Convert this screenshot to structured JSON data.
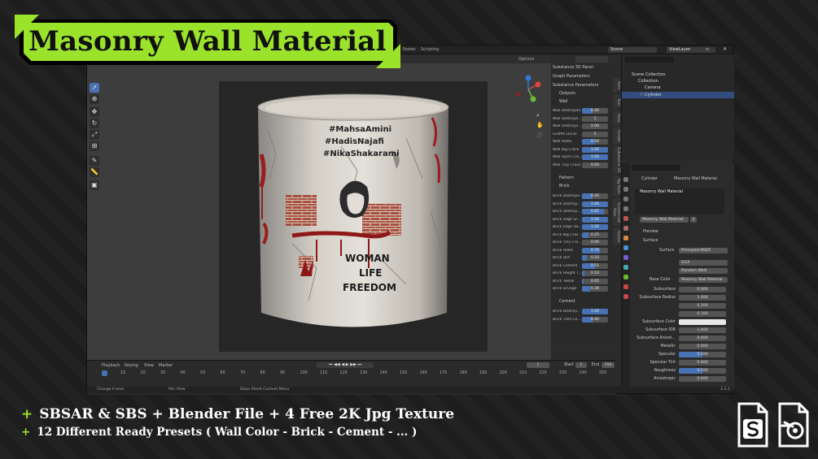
{
  "banner": {
    "title": "Masonry Wall Material",
    "bullets": [
      "SBSAR & SBS + Blender File + 4 Free 2K Jpg Texture",
      "12 Different Ready Presets ( Wall Color - Brick - Cement - ... )"
    ],
    "plus": "+",
    "accent_color": "#9be22a",
    "file_icons": [
      "substance-file-icon",
      "blender-file-icon"
    ]
  },
  "blender": {
    "tabs": [
      "Nodes",
      "Scripting"
    ],
    "scene_label": "Scene",
    "view_layer": "ViewLayer",
    "options_label": "Options",
    "substance_panel": {
      "headers": {
        "panel": "Substance 3D Panel",
        "graph": "Graph Parameters",
        "params": "Substance Parameters",
        "outputs": "Outputs",
        "wall": "Wall",
        "pattern": "Pattern",
        "brick": "Brick",
        "cement": "Cement"
      },
      "wall_params": [
        {
          "label": "Wall Destroyed",
          "value": "0.40",
          "fill": 0.4
        },
        {
          "label": "Wall Destroye...",
          "value": "1",
          "fill": 0
        },
        {
          "label": "Wall Destroye...",
          "value": "2.00",
          "fill": 0
        },
        {
          "label": "Graffiti Decal",
          "value": "1",
          "fill": 0
        },
        {
          "label": "Wall Holes",
          "value": "0.50",
          "fill": 0.5
        },
        {
          "label": "Wall Big Crack",
          "value": "1.00",
          "fill": 1.0
        },
        {
          "label": "Wall Open Cra...",
          "value": "1.00",
          "fill": 1.0
        },
        {
          "label": "Wall Tiny Crack",
          "value": "0.00",
          "fill": 0
        }
      ],
      "brick_params": [
        {
          "label": "Brick Destroye...",
          "value": "0.40",
          "fill": 0.4
        },
        {
          "label": "Brick Destroy...",
          "value": "1.00",
          "fill": 1.0
        },
        {
          "label": "Brick Destroy...",
          "value": "0.85",
          "fill": 0.85
        },
        {
          "label": "Brick edge Sc...",
          "value": "1.00",
          "fill": 1.0
        },
        {
          "label": "Brick Edge Da...",
          "value": "1.00",
          "fill": 1.0
        },
        {
          "label": "Brick Big Crac...",
          "value": "0.25",
          "fill": 0.25
        },
        {
          "label": "Brick Tiny Cra...",
          "value": "0.00",
          "fill": 0
        },
        {
          "label": "Brick Holes",
          "value": "0.70",
          "fill": 0.7
        },
        {
          "label": "Brick Dirt",
          "value": "0.20",
          "fill": 0.2
        },
        {
          "label": "Brick Cement",
          "value": "0.51",
          "fill": 0.51
        },
        {
          "label": "Brick Height T...",
          "value": "0.10",
          "fill": 0.1
        },
        {
          "label": "Brick Tweak",
          "value": "0.05",
          "fill": 0.05
        },
        {
          "label": "Brick Grunge",
          "value": "0.30",
          "fill": 0.3
        }
      ],
      "cement_params": [
        {
          "label": "Brick Destroy...",
          "value": "1.00",
          "fill": 1.0
        },
        {
          "label": "Brick Tiles Co...",
          "value": "0.40",
          "fill": 0.4
        }
      ]
    },
    "side_tabs": [
      "Item",
      "Tool",
      "View",
      "Create",
      "Substance 3D",
      "Bg Tools",
      "Screencast Keys",
      "Quixel"
    ],
    "outliner": {
      "scene_collection": "Scene Collection",
      "collection": "Collection",
      "camera": "Camera",
      "cylinder": "Cylinder"
    },
    "properties": {
      "object_name": "Cylinder",
      "material_name": "Masonry Wall Material",
      "slot_material": "Masonry Wall Material",
      "users": "2",
      "preview": "Preview",
      "surface_header": "Surface",
      "surface_label": "Surface",
      "surface_value": "Principled BSDF",
      "distribution": "GGX",
      "subsurface_method": "Random Walk",
      "base_color_label": "Base Color",
      "base_color_value": "Masonry Wall Material",
      "rows": [
        {
          "label": "Subsurface",
          "value": "0.000",
          "fill": 0
        },
        {
          "label": "Subsurface Radius",
          "value": "1.000",
          "fill": 0
        },
        {
          "label": "",
          "value": "0.200",
          "fill": 0
        },
        {
          "label": "",
          "value": "0.100",
          "fill": 0
        },
        {
          "label": "Subsurface Color",
          "value": "",
          "fill": 0
        },
        {
          "label": "Subsurface IOR",
          "value": "1.400",
          "fill": 0
        },
        {
          "label": "Subsurface Anisot...",
          "value": "0.000",
          "fill": 0
        },
        {
          "label": "Metallic",
          "value": "0.000",
          "fill": 0
        },
        {
          "label": "Specular",
          "value": "0.500",
          "fill": 0.5
        },
        {
          "label": "Specular Tint",
          "value": "0.000",
          "fill": 0
        },
        {
          "label": "Roughness",
          "value": "0.500",
          "fill": 0.5
        },
        {
          "label": "Anisotropic",
          "value": "0.000",
          "fill": 0
        }
      ]
    },
    "timeline": {
      "menus": [
        "Playback",
        "Keying",
        "View",
        "Marker"
      ],
      "current_frame": "1",
      "start_label": "Start",
      "start": "1",
      "end_label": "End",
      "end": "250",
      "ticks": [
        "1",
        "10",
        "20",
        "30",
        "40",
        "50",
        "60",
        "70",
        "80",
        "90",
        "100",
        "110",
        "120",
        "130",
        "140",
        "150",
        "160",
        "170",
        "180",
        "190",
        "200",
        "210",
        "220",
        "230",
        "240",
        "250"
      ]
    },
    "status": {
      "change_frame": "Change Frame",
      "pan_view": "Pan View",
      "context_menu": "Dope Sheet Context Menu",
      "version": "3.3.1"
    },
    "mug_text": {
      "hashtags": [
        "#MahsaAmini",
        "#HadisNajafi",
        "#NikaShakarami"
      ],
      "slogan": [
        "WOMAN",
        "LIFE",
        "FREEDOM"
      ]
    }
  }
}
